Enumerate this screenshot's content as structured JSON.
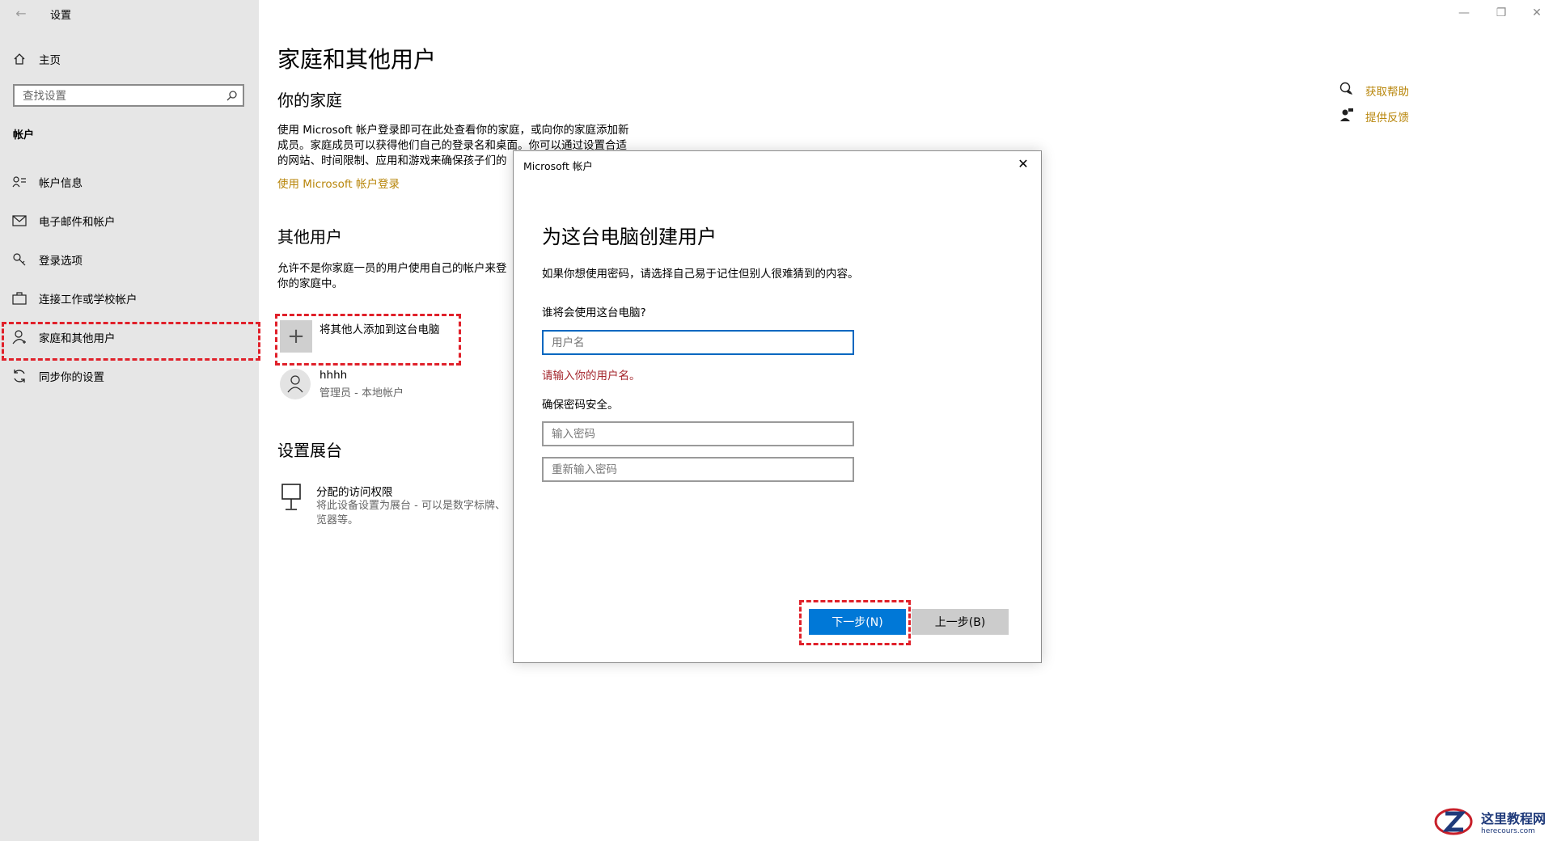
{
  "app": {
    "title": "设置"
  },
  "sidebar": {
    "home_label": "主页",
    "search_placeholder": "查找设置",
    "section_label": "帐户",
    "items": [
      {
        "label": "帐户信息",
        "icon": "account-info-icon"
      },
      {
        "label": "电子邮件和帐户",
        "icon": "mail-icon"
      },
      {
        "label": "登录选项",
        "icon": "key-icon"
      },
      {
        "label": "连接工作或学校帐户",
        "icon": "briefcase-icon"
      },
      {
        "label": "家庭和其他用户",
        "icon": "person-add-icon",
        "selected": true
      },
      {
        "label": "同步你的设置",
        "icon": "sync-icon"
      }
    ]
  },
  "main": {
    "title": "家庭和其他用户",
    "family": {
      "heading": "你的家庭",
      "desc_lines": [
        "使用 Microsoft 帐户登录即可在此处查看你的家庭，或向你的家庭添加新",
        "成员。家庭成员可以获得他们自己的登录名和桌面。你可以通过设置合适",
        "的网站、时间限制、应用和游戏来确保孩子们的"
      ],
      "link": "使用 Microsoft 帐户登录"
    },
    "others": {
      "heading": "其他用户",
      "desc_lines": [
        "允许不是你家庭一员的用户使用自己的帐户来登",
        "你的家庭中。"
      ],
      "add_label": "将其他人添加到这台电脑",
      "user": {
        "name": "hhhh",
        "sub": "管理员 - 本地帐户"
      }
    },
    "kiosk": {
      "heading": "设置展台",
      "title": "分配的访问权限",
      "desc_lines": [
        "将此设备设置为展台 - 可以是数字标牌、",
        "览器等。"
      ]
    }
  },
  "help": {
    "get_help": "获取帮助",
    "feedback": "提供反馈"
  },
  "window_controls": {
    "minimize": "—",
    "restore": "❐",
    "close": "✕"
  },
  "dialog": {
    "title": "Microsoft 帐户",
    "close": "✕",
    "heading": "为这台电脑创建用户",
    "intro": "如果你想使用密码，请选择自己易于记住但别人很难猜到的内容。",
    "question": "谁将会使用这台电脑?",
    "username_placeholder": "用户名",
    "error": "请输入你的用户名。",
    "secure_label": "确保密码安全。",
    "password_placeholder": "输入密码",
    "reenter_placeholder": "重新输入密码",
    "next_button": "下一步(N)",
    "back_button": "上一步(B)"
  },
  "watermark": {
    "line1": "这里教程网",
    "line2": "herecours.com"
  },
  "colors": {
    "accent": "#0078d7",
    "link": "#b8860b",
    "highlight": "#e0202a",
    "error": "#a4262c"
  }
}
